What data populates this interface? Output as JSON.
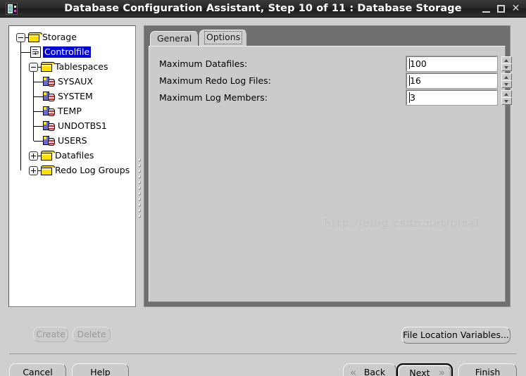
{
  "window": {
    "title": "Database Configuration Assistant, Step 10 of 11 : Database Storage",
    "app_icon": "database-app-icon",
    "minimize_label": "_",
    "maximize_label": "□",
    "close_label": "✕"
  },
  "tree": {
    "name": "storage-tree",
    "nodes": [
      {
        "label": "Storage",
        "icon": "folder-icon",
        "depth": 0,
        "toggle": "collapse",
        "selected": false
      },
      {
        "label": "Controlfile",
        "icon": "controlfile-icon",
        "depth": 1,
        "toggle": "none",
        "selected": true
      },
      {
        "label": "Tablespaces",
        "icon": "folder-icon",
        "depth": 1,
        "toggle": "collapse",
        "selected": false
      },
      {
        "label": "SYSAUX",
        "icon": "tablespace-icon",
        "depth": 2,
        "toggle": "none",
        "selected": false
      },
      {
        "label": "SYSTEM",
        "icon": "tablespace-icon",
        "depth": 2,
        "toggle": "none",
        "selected": false
      },
      {
        "label": "TEMP",
        "icon": "tablespace-icon",
        "depth": 2,
        "toggle": "none",
        "selected": false
      },
      {
        "label": "UNDOTBS1",
        "icon": "tablespace-icon",
        "depth": 2,
        "toggle": "none",
        "selected": false
      },
      {
        "label": "USERS",
        "icon": "tablespace-icon",
        "depth": 2,
        "toggle": "none",
        "selected": false
      },
      {
        "label": "Datafiles",
        "icon": "folder-icon",
        "depth": 1,
        "toggle": "expand",
        "selected": false
      },
      {
        "label": "Redo Log Groups",
        "icon": "folder-icon",
        "depth": 1,
        "toggle": "expand",
        "selected": false
      }
    ]
  },
  "tabs": [
    {
      "label": "General",
      "selected": false
    },
    {
      "label": "Options",
      "selected": true
    }
  ],
  "options_form": {
    "fields": [
      {
        "label": "Maximum Datafiles:",
        "value": "100"
      },
      {
        "label": "Maximum Redo Log Files:",
        "value": "16"
      },
      {
        "label": "Maximum Log Members:",
        "value": "3"
      }
    ]
  },
  "watermark": "http://blog.csdn.net/bisal",
  "buttons": {
    "create": "Create",
    "delete": "Delete",
    "file_location_variables": "File Location Variables...",
    "cancel": "Cancel",
    "help": "Help",
    "back": "Back",
    "next": "Next",
    "finish": "Finish",
    "back_chevron": "«",
    "next_chevron": "»"
  }
}
